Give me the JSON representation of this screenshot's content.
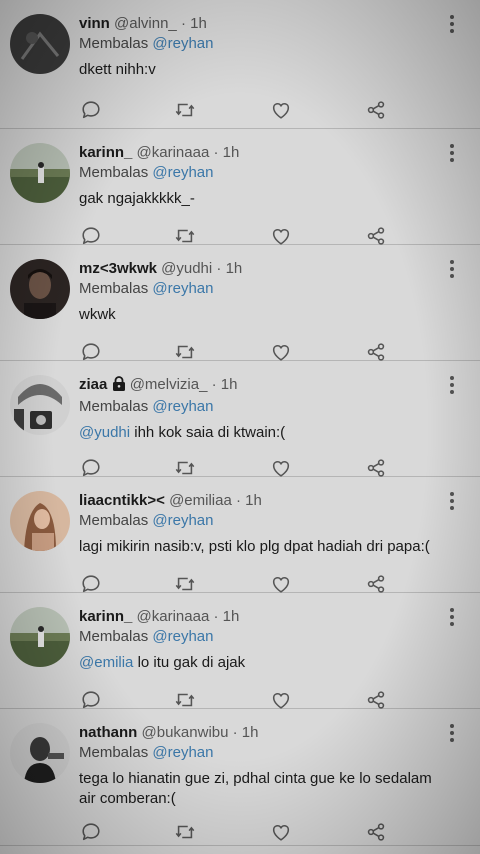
{
  "tweets": [
    {
      "name": "vinn",
      "handle": "@alvinn_",
      "time": "· 1h",
      "reply_prefix": "Membalas",
      "reply_to": "@reyhan",
      "mention": "",
      "text": "dkett nihh:v",
      "avatar": "avatar-dark"
    },
    {
      "name": "karinn_",
      "handle": "@karinaaa",
      "time": "· 1h",
      "reply_prefix": "Membalas",
      "reply_to": "@reyhan",
      "mention": "",
      "text": "gak ngajakkkkk_-",
      "avatar": "avatar-field"
    },
    {
      "name": "mz<3wkwk",
      "handle": "@yudhi",
      "time": "· 1h",
      "reply_prefix": "Membalas",
      "reply_to": "@reyhan",
      "mention": "",
      "text": "wkwk",
      "avatar": "avatar-man"
    },
    {
      "name": "ziaa",
      "handle": "@melvizia_",
      "time": "· 1h",
      "reply_prefix": "Membalas",
      "reply_to": "@reyhan",
      "mention": "@yudhi",
      "text": " ihh kok saia di ktwain:(",
      "avatar": "avatar-camera",
      "locked": true
    },
    {
      "name": "liaacntikk><",
      "handle": "@emiliaa",
      "time": "· 1h",
      "reply_prefix": "Membalas",
      "reply_to": "@reyhan",
      "mention": "",
      "text": "lagi mikirin nasib:v, psti klo plg dpat hadiah dri papa:(",
      "avatar": "avatar-girl"
    },
    {
      "name": "karinn_",
      "handle": "@karinaaa",
      "time": "· 1h",
      "reply_prefix": "Membalas",
      "reply_to": "@reyhan",
      "mention": "@emilia",
      "text": " lo itu gak di ajak",
      "avatar": "avatar-field"
    },
    {
      "name": "nathann",
      "handle": "@bukanwibu",
      "time": "· 1h",
      "reply_prefix": "Membalas",
      "reply_to": "@reyhan",
      "mention": "",
      "text": "tega lo hianatin gue zi, pdhal cinta gue ke lo sedalam air comberan:(",
      "avatar": "avatar-bw"
    }
  ],
  "icons": {
    "reply": "reply-icon",
    "retweet": "retweet-icon",
    "like": "heart-icon",
    "share": "share-icon",
    "more": "more-vertical-icon",
    "lock": "lock-icon"
  },
  "colors": {
    "background": "#d9d9d9",
    "link": "#3b77a8",
    "icon": "#555555"
  }
}
